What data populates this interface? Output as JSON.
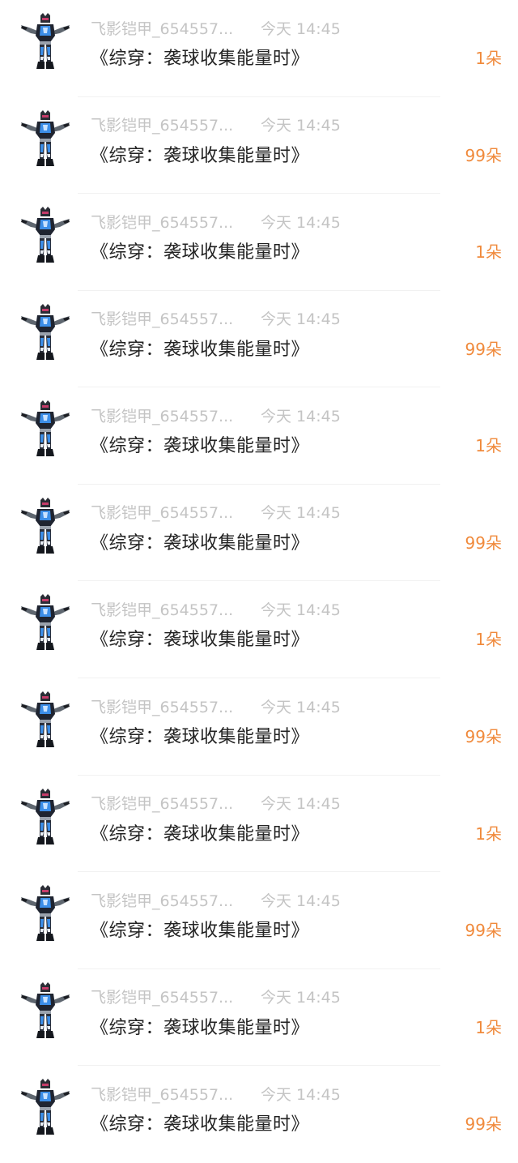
{
  "colors": {
    "meta_text": "#c4c4c4",
    "title_text": "#222222",
    "gift_text": "#f08a3c"
  },
  "items": [
    {
      "avatar_icon": "armor-hero-avatar-icon",
      "username": "飞影铠甲_654557...",
      "time": "今天 14:45",
      "title": "《综穿：袭球收集能量时》",
      "gift": "1朵"
    },
    {
      "avatar_icon": "armor-hero-avatar-icon",
      "username": "飞影铠甲_654557...",
      "time": "今天 14:45",
      "title": "《综穿：袭球收集能量时》",
      "gift": "99朵"
    },
    {
      "avatar_icon": "armor-hero-avatar-icon",
      "username": "飞影铠甲_654557...",
      "time": "今天 14:45",
      "title": "《综穿：袭球收集能量时》",
      "gift": "1朵"
    },
    {
      "avatar_icon": "armor-hero-avatar-icon",
      "username": "飞影铠甲_654557...",
      "time": "今天 14:45",
      "title": "《综穿：袭球收集能量时》",
      "gift": "99朵"
    },
    {
      "avatar_icon": "armor-hero-avatar-icon",
      "username": "飞影铠甲_654557...",
      "time": "今天 14:45",
      "title": "《综穿：袭球收集能量时》",
      "gift": "1朵"
    },
    {
      "avatar_icon": "armor-hero-avatar-icon",
      "username": "飞影铠甲_654557...",
      "time": "今天 14:45",
      "title": "《综穿：袭球收集能量时》",
      "gift": "99朵"
    },
    {
      "avatar_icon": "armor-hero-avatar-icon",
      "username": "飞影铠甲_654557...",
      "time": "今天 14:45",
      "title": "《综穿：袭球收集能量时》",
      "gift": "1朵"
    },
    {
      "avatar_icon": "armor-hero-avatar-icon",
      "username": "飞影铠甲_654557...",
      "time": "今天 14:45",
      "title": "《综穿：袭球收集能量时》",
      "gift": "99朵"
    },
    {
      "avatar_icon": "armor-hero-avatar-icon",
      "username": "飞影铠甲_654557...",
      "time": "今天 14:45",
      "title": "《综穿：袭球收集能量时》",
      "gift": "1朵"
    },
    {
      "avatar_icon": "armor-hero-avatar-icon",
      "username": "飞影铠甲_654557...",
      "time": "今天 14:45",
      "title": "《综穿：袭球收集能量时》",
      "gift": "99朵"
    },
    {
      "avatar_icon": "armor-hero-avatar-icon",
      "username": "飞影铠甲_654557...",
      "time": "今天 14:45",
      "title": "《综穿：袭球收集能量时》",
      "gift": "1朵"
    },
    {
      "avatar_icon": "armor-hero-avatar-icon",
      "username": "飞影铠甲_654557...",
      "time": "今天 14:45",
      "title": "《综穿：袭球收集能量时》",
      "gift": "99朵"
    }
  ]
}
